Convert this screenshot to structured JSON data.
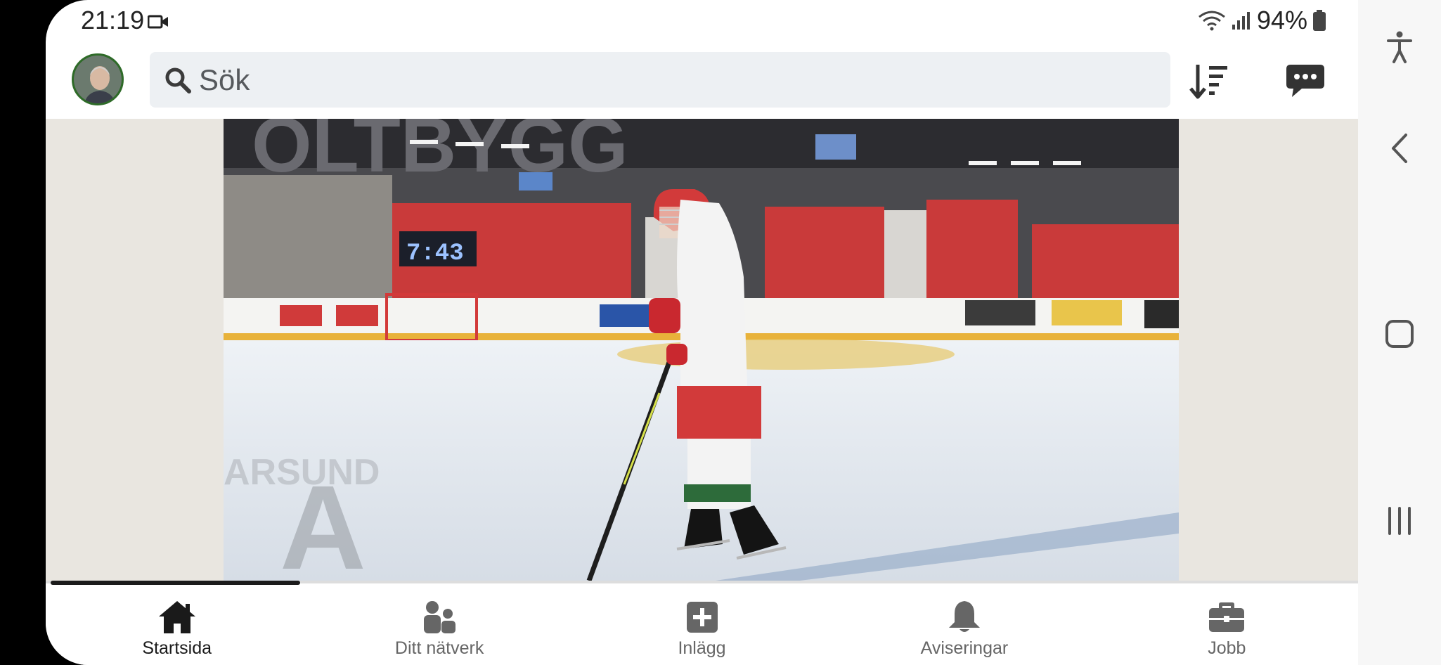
{
  "status": {
    "time": "21:19",
    "battery": "94%"
  },
  "search": {
    "placeholder": "Sök"
  },
  "video": {
    "scoreboard": "7:43",
    "progress": 0.19
  },
  "nav": {
    "items": [
      {
        "label": "Startsida",
        "icon": "home-icon",
        "active": true
      },
      {
        "label": "Ditt nätverk",
        "icon": "network-icon",
        "active": false
      },
      {
        "label": "Inlägg",
        "icon": "plus-square-icon",
        "active": false
      },
      {
        "label": "Aviseringar",
        "icon": "bell-icon",
        "active": false
      },
      {
        "label": "Jobb",
        "icon": "briefcase-icon",
        "active": false
      }
    ]
  },
  "colors": {
    "active": "#1a1a1a",
    "inactive": "#666666",
    "icon_inactive": "#666666"
  }
}
